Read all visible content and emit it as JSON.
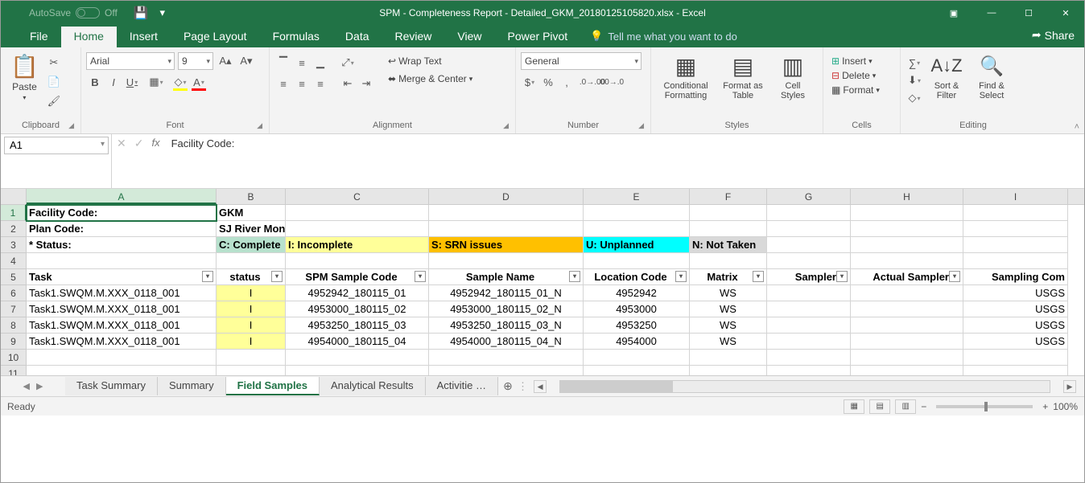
{
  "titlebar": {
    "autosave_label": "AutoSave",
    "autosave_state": "Off",
    "title": "SPM - Completeness Report - Detailed_GKM_20180125105820.xlsx - Excel"
  },
  "tabs": {
    "file": "File",
    "home": "Home",
    "insert": "Insert",
    "page_layout": "Page Layout",
    "formulas": "Formulas",
    "data": "Data",
    "review": "Review",
    "view": "View",
    "power_pivot": "Power Pivot",
    "tellme": "Tell me what you want to do",
    "share": "Share"
  },
  "ribbon": {
    "clipboard": {
      "label": "Clipboard",
      "paste": "Paste"
    },
    "font": {
      "label": "Font",
      "name": "Arial",
      "size": "9"
    },
    "alignment": {
      "label": "Alignment",
      "wrap": "Wrap Text",
      "merge": "Merge & Center"
    },
    "number": {
      "label": "Number",
      "format": "General"
    },
    "styles": {
      "label": "Styles",
      "conditional": "Conditional Formatting",
      "fmt_table": "Format as Table",
      "cell_styles": "Cell Styles"
    },
    "cells": {
      "label": "Cells",
      "insert": "Insert",
      "delete": "Delete",
      "format": "Format"
    },
    "editing": {
      "label": "Editing",
      "sort": "Sort & Filter",
      "find": "Find & Select"
    }
  },
  "formula_bar": {
    "name_box": "A1",
    "value": "Facility Code:"
  },
  "columns": [
    "A",
    "B",
    "C",
    "D",
    "E",
    "F",
    "G",
    "H",
    "I"
  ],
  "col_widths": [
    "wA",
    "wB",
    "wC",
    "wD",
    "wE",
    "wF",
    "wG",
    "wH",
    "wI"
  ],
  "sheet": {
    "r1": {
      "A": "Facility Code:",
      "B": "GKM"
    },
    "r2": {
      "A": "Plan Code:",
      "B": "SJ River Monit XXX"
    },
    "r3": {
      "A": "* Status:",
      "B": "C: Complete",
      "C": "I: Incomplete",
      "D": "S: SRN issues",
      "E": "U: Unplanned",
      "F": "N: Not Taken"
    },
    "headers": {
      "A": "Task",
      "B": "status",
      "C": "SPM Sample Code",
      "D": "Sample Name",
      "E": "Location Code",
      "F": "Matrix",
      "G": "Sampler",
      "H": "Actual Sampler",
      "I": "Sampling Com"
    },
    "data": [
      {
        "A": "Task1.SWQM.M.XXX_0118_001",
        "B": "I",
        "C": "4952942_180115_01",
        "D": "4952942_180115_01_N",
        "E": "4952942",
        "F": "WS",
        "G": "",
        "H": "",
        "I": "USGS"
      },
      {
        "A": "Task1.SWQM.M.XXX_0118_001",
        "B": "I",
        "C": "4953000_180115_02",
        "D": "4953000_180115_02_N",
        "E": "4953000",
        "F": "WS",
        "G": "",
        "H": "",
        "I": "USGS"
      },
      {
        "A": "Task1.SWQM.M.XXX_0118_001",
        "B": "I",
        "C": "4953250_180115_03",
        "D": "4953250_180115_03_N",
        "E": "4953250",
        "F": "WS",
        "G": "",
        "H": "",
        "I": "USGS"
      },
      {
        "A": "Task1.SWQM.M.XXX_0118_001",
        "B": "I",
        "C": "4954000_180115_04",
        "D": "4954000_180115_04_N",
        "E": "4954000",
        "F": "WS",
        "G": "",
        "H": "",
        "I": "USGS"
      }
    ]
  },
  "sheet_tabs": {
    "tabs": [
      "Task Summary",
      "Summary",
      "Field Samples",
      "Analytical Results",
      "Activitie …"
    ],
    "active": 2
  },
  "statusbar": {
    "ready": "Ready",
    "zoom": "100%"
  }
}
